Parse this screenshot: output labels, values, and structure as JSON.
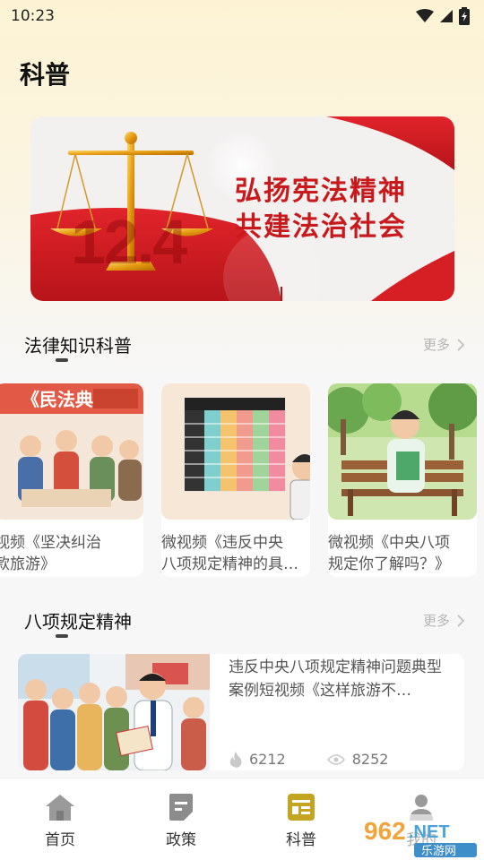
{
  "status_bar": {
    "time": "10:23",
    "icons": [
      "wifi-icon",
      "signal-icon",
      "battery-icon"
    ]
  },
  "header": {
    "title": "科普"
  },
  "banner": {
    "slogan_line1": "弘扬宪法精神",
    "slogan_line2": "共建法治社会",
    "date_graphic": "12.4",
    "icon": "scales-of-justice-icon"
  },
  "sections": [
    {
      "title": "法律知识科普",
      "more": "更多"
    },
    {
      "title": "八项规定精神",
      "more": "更多"
    }
  ],
  "video_cards": [
    {
      "title": "视频《坚决纠治\n款旅游》",
      "thumb_label": "《民法典"
    },
    {
      "title": "微视频《违反中央\n八项规定精神的具…",
      "thumb_label": ""
    },
    {
      "title": "微视频《中央八项\n规定你了解吗？》",
      "thumb_label": ""
    }
  ],
  "list_item": {
    "title": "违反中央八项规定精神问题典型案例短视频《这样旅游不…",
    "likes": "6212",
    "views": "8252",
    "like_icon": "flame-icon",
    "view_icon": "eye-icon"
  },
  "bottom_nav": [
    {
      "label": "首页",
      "icon": "home-icon"
    },
    {
      "label": "政策",
      "icon": "document-icon"
    },
    {
      "label": "科普",
      "icon": "science-icon"
    },
    {
      "label": "我的",
      "icon": "user-icon"
    }
  ],
  "watermark": {
    "brand": "962",
    "suffix": ".NET",
    "site": "乐游网"
  },
  "colors": {
    "accent": "#c3a521",
    "banner_red": "#c8191c"
  }
}
